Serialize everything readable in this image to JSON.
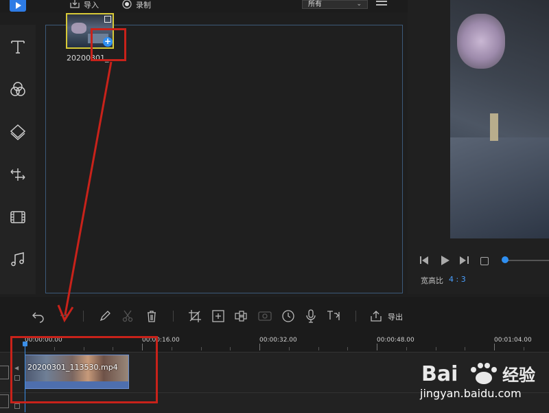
{
  "top": {
    "import_label": "导入",
    "record_label": "录制",
    "filter_value": "所有"
  },
  "left_toolbar": {
    "tools": [
      "text-icon",
      "filter-icon",
      "overlay-icon",
      "transition-icon",
      "element-icon",
      "music-icon"
    ]
  },
  "media": {
    "items": [
      {
        "name": "20200301_"
      }
    ]
  },
  "preview": {
    "aspect_label": "宽高比",
    "aspect_value": "4 : 3",
    "progress": 0.0
  },
  "timeline_toolbar": {
    "tools": [
      "undo-icon",
      "redo-icon",
      "edit-icon",
      "cut-icon",
      "delete-icon",
      "crop-icon",
      "zoom-icon",
      "mosaic-icon",
      "freeze-frame-icon",
      "duration-icon",
      "voiceover-icon",
      "text-to-speech-icon"
    ],
    "export_label": "导出"
  },
  "ruler": {
    "ticks": [
      "00:00:00.00",
      "00:00:16.00",
      "00:00:32.00",
      "00:00:48.00",
      "00:01:04.00"
    ]
  },
  "timeline": {
    "clip_name": "20200301_113530.mp4"
  },
  "watermark": {
    "brand": "Baidu经验",
    "url": "jingyan.baidu.com"
  },
  "colors": {
    "accent": "#2f8ff1",
    "annotation": "#c8221a",
    "thumb_selected": "#d7c937"
  }
}
